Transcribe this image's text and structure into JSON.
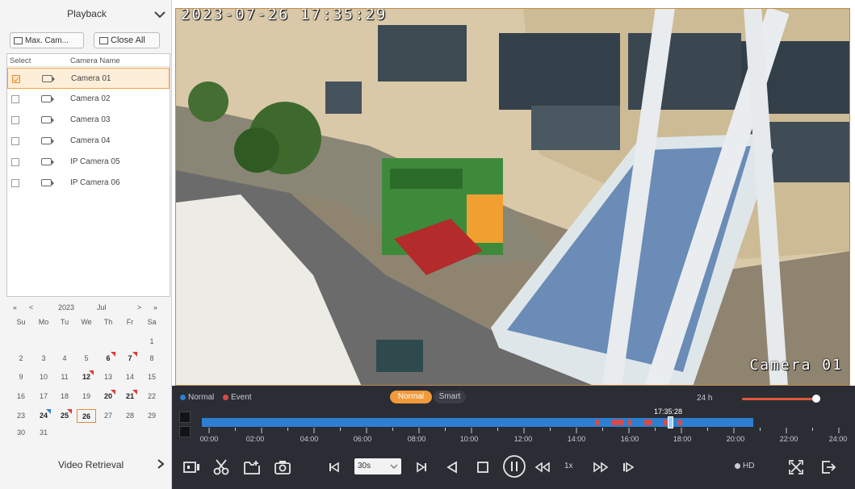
{
  "playback_panel": {
    "title": "Playback",
    "max_camera_button": "Max. Cam...",
    "close_all_button": "Close All",
    "table_headers": {
      "select": "Select",
      "camera_name": "Camera Name"
    },
    "cameras": [
      {
        "name": "Camera 01",
        "checked": true
      },
      {
        "name": "Camera 02",
        "checked": false
      },
      {
        "name": "Camera 03",
        "checked": false
      },
      {
        "name": "Camera 04",
        "checked": false
      },
      {
        "name": "IP Camera 05",
        "checked": false
      },
      {
        "name": "IP Camera 06",
        "checked": false
      }
    ]
  },
  "calendar": {
    "year": "2023",
    "month": "Jul",
    "weekdays": [
      "Su",
      "Mo",
      "Tu",
      "We",
      "Th",
      "Fr",
      "Sa"
    ],
    "days": {
      "d1": "1",
      "d2": "2",
      "d3": "3",
      "d4": "4",
      "d5": "5",
      "d6": "6",
      "d7": "7",
      "d8": "8",
      "d9": "9",
      "d10": "10",
      "d11": "11",
      "d12": "12",
      "d13": "13",
      "d14": "14",
      "d15": "15",
      "d16": "16",
      "d17": "17",
      "d18": "18",
      "d19": "19",
      "d20": "20",
      "d21": "21",
      "d22": "22",
      "d23": "23",
      "d24": "24",
      "d25": "25",
      "d26": "26",
      "d27": "27",
      "d28": "28",
      "d29": "29",
      "d30": "30",
      "d31": "31"
    },
    "selected_day": "26"
  },
  "video_retrieval": {
    "label": "Video Retrieval"
  },
  "video": {
    "osd_timestamp": "2023-07-26 17:35:29",
    "osd_camera": "Camera 01"
  },
  "timeline": {
    "legend_normal": "Normal",
    "legend_event": "Event",
    "mode_normal": "Normal",
    "mode_smart": "Smart",
    "span": "24 h",
    "current_time": "17:35:28",
    "tick_labels": [
      "00:00",
      "02:00",
      "04:00",
      "06:00",
      "08:00",
      "10:00",
      "12:00",
      "14:00",
      "16:00",
      "18:00",
      "20:00",
      "22:00",
      "24:00"
    ],
    "colors": {
      "normal": "#2d7fd0",
      "event": "#d94a4a",
      "accent": "#f29a3a"
    }
  },
  "controls": {
    "interval": "30s",
    "speed": "1x",
    "quality": "HD"
  }
}
